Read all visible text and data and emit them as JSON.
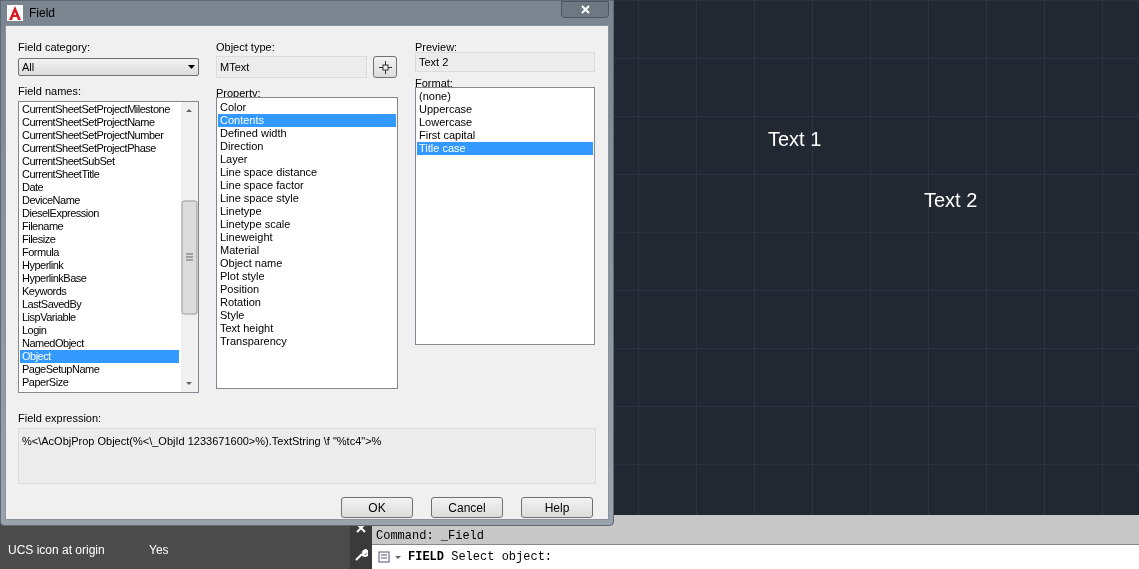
{
  "window": {
    "title": "Field"
  },
  "field_category": {
    "label": "Field category:",
    "value": "All"
  },
  "field_names": {
    "label": "Field names:",
    "items": [
      {
        "label": "CurrentSheetSetProjectMilestone",
        "selected": false
      },
      {
        "label": "CurrentSheetSetProjectName",
        "selected": false
      },
      {
        "label": "CurrentSheetSetProjectNumber",
        "selected": false
      },
      {
        "label": "CurrentSheetSetProjectPhase",
        "selected": false
      },
      {
        "label": "CurrentSheetSubSet",
        "selected": false
      },
      {
        "label": "CurrentSheetTitle",
        "selected": false
      },
      {
        "label": "Date",
        "selected": false
      },
      {
        "label": "DeviceName",
        "selected": false
      },
      {
        "label": "DieselExpression",
        "selected": false
      },
      {
        "label": "Filename",
        "selected": false
      },
      {
        "label": "Filesize",
        "selected": false
      },
      {
        "label": "Formula",
        "selected": false
      },
      {
        "label": "Hyperlink",
        "selected": false
      },
      {
        "label": "HyperlinkBase",
        "selected": false
      },
      {
        "label": "Keywords",
        "selected": false
      },
      {
        "label": "LastSavedBy",
        "selected": false
      },
      {
        "label": "LispVariable",
        "selected": false
      },
      {
        "label": "Login",
        "selected": false
      },
      {
        "label": "NamedObject",
        "selected": false
      },
      {
        "label": "Object",
        "selected": true
      },
      {
        "label": "PageSetupName",
        "selected": false
      },
      {
        "label": "PaperSize",
        "selected": false
      }
    ]
  },
  "object_type": {
    "label": "Object type:",
    "value": "MText"
  },
  "property": {
    "label": "Property:",
    "items": [
      {
        "label": "Color",
        "selected": false
      },
      {
        "label": "Contents",
        "selected": true
      },
      {
        "label": "Defined width",
        "selected": false
      },
      {
        "label": "Direction",
        "selected": false
      },
      {
        "label": "Layer",
        "selected": false
      },
      {
        "label": "Line space distance",
        "selected": false
      },
      {
        "label": "Line space factor",
        "selected": false
      },
      {
        "label": "Line space style",
        "selected": false
      },
      {
        "label": "Linetype",
        "selected": false
      },
      {
        "label": "Linetype scale",
        "selected": false
      },
      {
        "label": "Lineweight",
        "selected": false
      },
      {
        "label": "Material",
        "selected": false
      },
      {
        "label": "Object name",
        "selected": false
      },
      {
        "label": "Plot style",
        "selected": false
      },
      {
        "label": "Position",
        "selected": false
      },
      {
        "label": "Rotation",
        "selected": false
      },
      {
        "label": "Style",
        "selected": false
      },
      {
        "label": "Text height",
        "selected": false
      },
      {
        "label": "Transparency",
        "selected": false
      }
    ]
  },
  "preview": {
    "label": "Preview:",
    "value": "Text 2"
  },
  "format": {
    "label": "Format:",
    "items": [
      {
        "label": "(none)",
        "selected": false
      },
      {
        "label": "Uppercase",
        "selected": false
      },
      {
        "label": "Lowercase",
        "selected": false
      },
      {
        "label": "First capital",
        "selected": false
      },
      {
        "label": "Title case",
        "selected": true
      }
    ]
  },
  "field_expression": {
    "label": "Field expression:",
    "value": "%<\\AcObjProp Object(%<\\_ObjId 1233671600>%).TextString \\f \"%tc4\">%"
  },
  "buttons": [
    "OK",
    "Cancel",
    "Help"
  ],
  "canvas": {
    "texts": [
      "Text 1",
      "Text 2"
    ]
  },
  "properties_panel": {
    "rows": [
      {
        "name": "UCS icon at origin",
        "value": "Yes"
      }
    ]
  },
  "command_line": {
    "history": "Command: _Field",
    "command": "FIELD",
    "prompt": "Select object:"
  }
}
